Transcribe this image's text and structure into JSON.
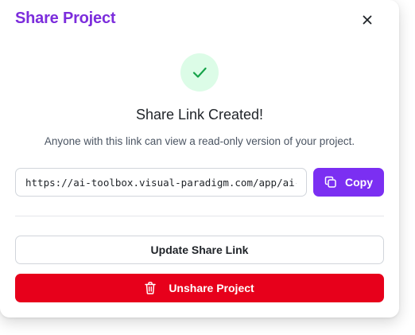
{
  "dialog": {
    "title": "Share Project",
    "close_icon": "close-icon"
  },
  "status": {
    "icon": "check-icon",
    "heading": "Share Link Created!",
    "description": "Anyone with this link can view a read-only version of your project."
  },
  "share_link": {
    "value": "https://ai-toolbox.visual-paradigm.com/app/ai-",
    "copy_label": "Copy",
    "copy_icon": "copy-icon"
  },
  "actions": {
    "update_label": "Update Share Link",
    "unshare_label": "Unshare Project",
    "unshare_icon": "trash-icon"
  },
  "colors": {
    "accent": "#7b2ff2",
    "title": "#7c2ddc",
    "danger": "#e7001b",
    "success_bg": "#dcfce7",
    "success": "#16a34a"
  }
}
